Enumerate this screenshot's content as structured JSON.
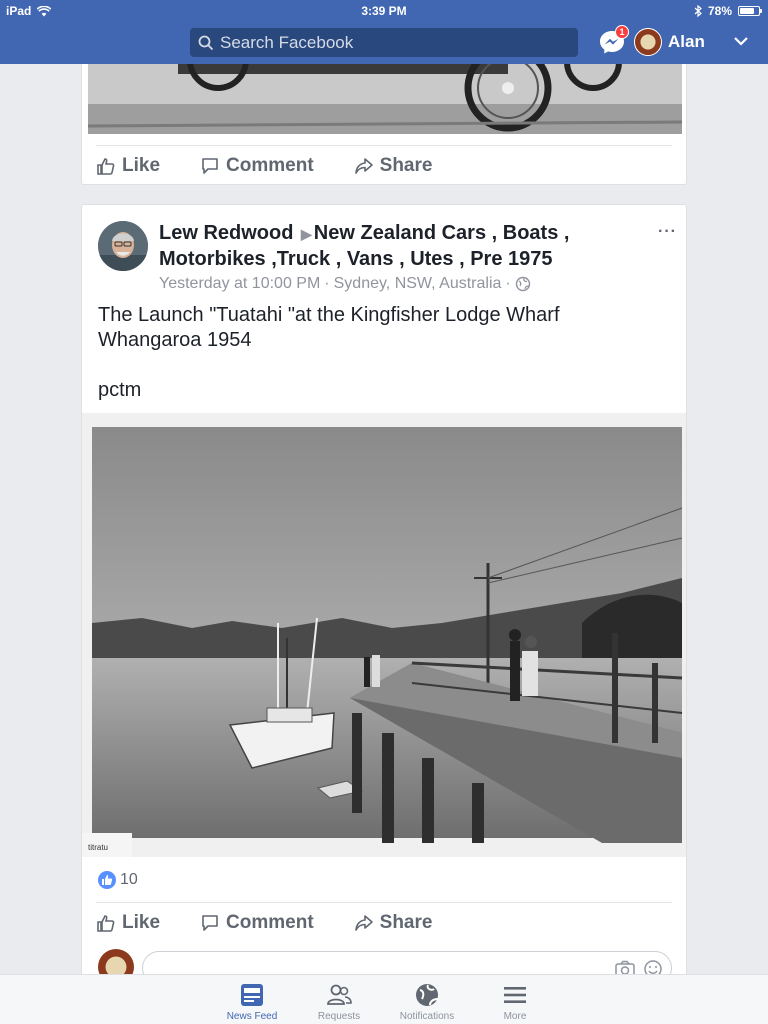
{
  "status_bar": {
    "device": "iPad",
    "time": "3:39 PM",
    "battery": "78%",
    "battery_level": 0.78
  },
  "header": {
    "search_placeholder": "Search Facebook",
    "messenger_badge": "1",
    "user_name": "Alan"
  },
  "previous_post": {
    "actions": {
      "like": "Like",
      "comment": "Comment",
      "share": "Share"
    }
  },
  "post": {
    "author": "Lew Redwood",
    "group": "New Zealand  Cars , Boats , Motorbikes ,Truck , Vans , Utes , Pre 1975",
    "timestamp": "Yesterday at 10:00 PM",
    "location": "Sydney, NSW, Australia",
    "separator": "·",
    "more": "···",
    "text_line1": "The Launch \"Tuatahi \"at the Kingfisher Lodge Wharf Whangaroa 1954",
    "text_line2": "",
    "text_line3": "pctm",
    "photo_watermark": "titratu",
    "reaction_count": "10",
    "actions": {
      "like": "Like",
      "comment": "Comment",
      "share": "Share"
    }
  },
  "tabbar": {
    "items": [
      {
        "label": "News Feed",
        "icon": "news-feed-icon",
        "active": true
      },
      {
        "label": "Requests",
        "icon": "friend-requests-icon",
        "active": false
      },
      {
        "label": "Notifications",
        "icon": "globe-icon",
        "active": false
      },
      {
        "label": "More",
        "icon": "hamburger-menu-icon",
        "active": false
      }
    ]
  },
  "colors": {
    "brand": "#4267b2",
    "search_bg": "#29487d",
    "badge": "#fa3e3e",
    "muted_text": "#606770",
    "like_blue": "#5890ff"
  }
}
